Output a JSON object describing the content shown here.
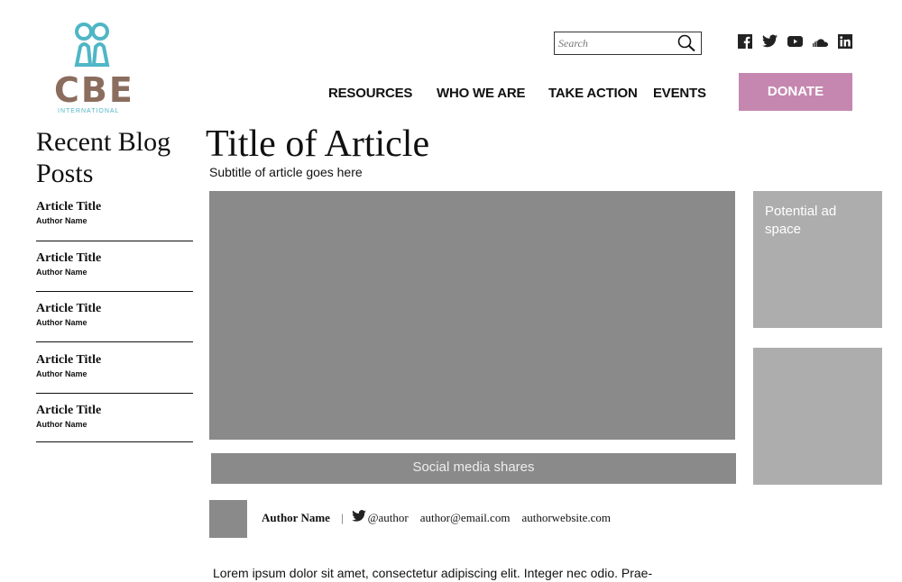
{
  "logo": {
    "text": "CBE",
    "subtext": "INTERNATIONAL"
  },
  "search": {
    "placeholder": "Search"
  },
  "social": [
    "facebook-icon",
    "twitter-icon",
    "youtube-icon",
    "soundcloud-icon",
    "linkedin-icon"
  ],
  "nav": {
    "resources": "RESOURCES",
    "who_we_are": "WHO WE ARE",
    "take_action": "TAKE ACTION",
    "events": "EVENTS",
    "donate": "DONATE"
  },
  "sidebar": {
    "title": "Recent Blog Posts",
    "posts": [
      {
        "title": "Article Title",
        "author": "Author Name"
      },
      {
        "title": "Article Title",
        "author": "Author Name"
      },
      {
        "title": "Article Title",
        "author": "Author Name"
      },
      {
        "title": "Article Title",
        "author": "Author Name"
      },
      {
        "title": "Article Title",
        "author": "Author Name"
      }
    ]
  },
  "article": {
    "title": "Title of Article",
    "subtitle": "Subtitle of article goes here",
    "shares_label": "Social media shares",
    "ad_label": "Potential ad space",
    "author": {
      "name": "Author Name",
      "separator": "|",
      "handle": "@author",
      "email": "author@email.com",
      "website": "authorwebsite.com"
    },
    "body": "Lorem ipsum dolor sit amet, consectetur adipiscing elit. Integer nec odio. Prae-"
  },
  "colors": {
    "donate": "#c587b0",
    "logo_brown": "#8b6d5e",
    "logo_teal": "#4fb6c6",
    "placeholder_dark": "#8a8a8a",
    "placeholder_light": "#adadad"
  }
}
